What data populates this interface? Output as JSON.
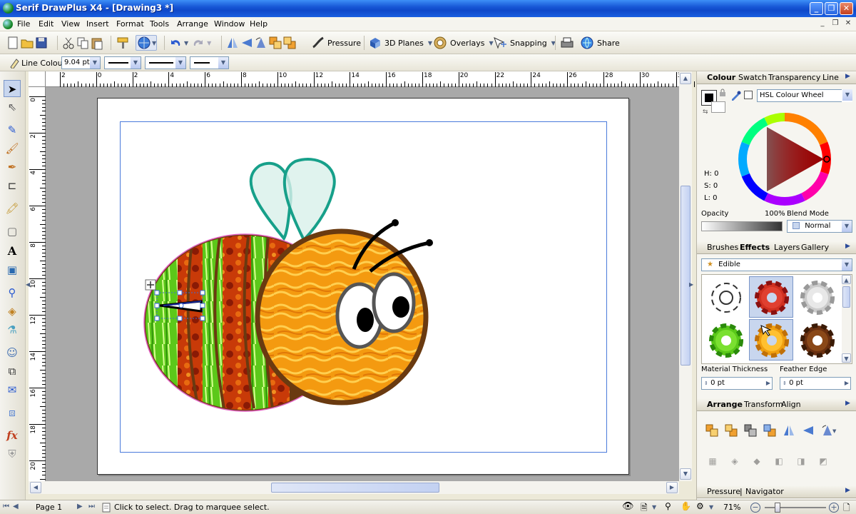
{
  "window": {
    "title": "Serif DrawPlus X4 - [Drawing3 *]"
  },
  "menu": {
    "items": [
      "File",
      "Edit",
      "View",
      "Insert",
      "Format",
      "Tools",
      "Arrange",
      "Window",
      "Help"
    ]
  },
  "toolbar": {
    "pressure_label": "Pressure",
    "planes_label": "3D Planes",
    "overlays_label": "Overlays",
    "snapping_label": "Snapping",
    "share_label": "Share"
  },
  "linebar": {
    "line_colour_label": "Line Colour",
    "line_width": "9.04 pt"
  },
  "ruler": {
    "h_ticks": [
      "2",
      "0",
      "2",
      "4",
      "6",
      "8",
      "10",
      "12",
      "14",
      "16",
      "18",
      "20",
      "22",
      "24",
      "26",
      "28",
      "30",
      "32"
    ],
    "v_ticks": [
      "0",
      "2",
      "4",
      "6",
      "8",
      "10",
      "12",
      "14",
      "16",
      "18",
      "20"
    ]
  },
  "colour_panel": {
    "tabs": [
      "Colour",
      "Swatch",
      "Transparency",
      "Line"
    ],
    "mode": "HSL Colour Wheel",
    "h": "H: 0",
    "s": "S: 0",
    "l": "L: 0",
    "opacity_label": "Opacity",
    "opacity_value": "100%",
    "blend_label": "Blend Mode",
    "blend_value": "Normal"
  },
  "effects_panel": {
    "tabs": [
      "Brushes",
      "Effects",
      "Layers",
      "Gallery"
    ],
    "category": "Edible",
    "material_label": "Material Thickness",
    "material_value": "0 pt",
    "feather_label": "Feather Edge",
    "feather_value": "0 pt"
  },
  "arrange_panel": {
    "tabs": [
      "Arrange",
      "Transform",
      "Align"
    ]
  },
  "bottom_panel": {
    "tabs": [
      "Pressure",
      "Navigator"
    ]
  },
  "status": {
    "page": "Page 1",
    "hint": "Click to select. Drag to marquee select.",
    "zoom": "71%"
  },
  "colors": {
    "accent": "#1a5fe0",
    "wing": "#17a08a",
    "selection": "#4a7adb"
  }
}
